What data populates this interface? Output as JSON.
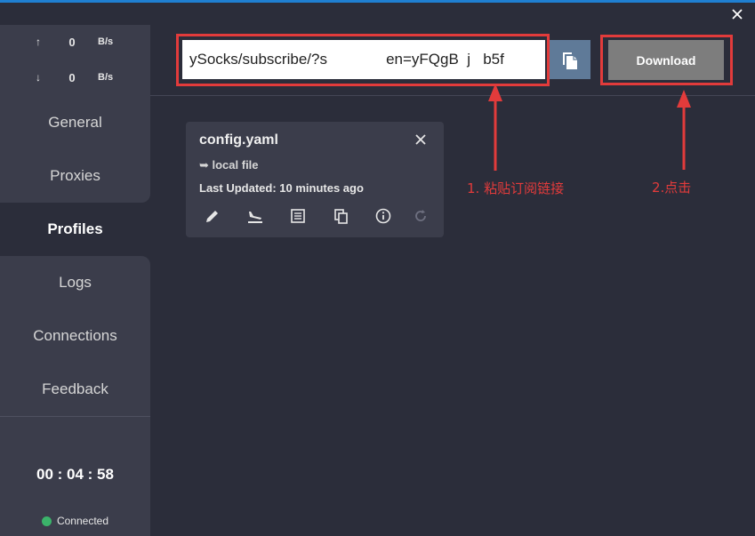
{
  "window": {
    "close_icon": "close-icon",
    "accent_color": "#1f7fd1"
  },
  "traffic": {
    "upload": {
      "arrow": "↑",
      "value": "0",
      "unit": "B/s"
    },
    "download": {
      "arrow": "↓",
      "value": "0",
      "unit": "B/s"
    }
  },
  "nav": {
    "items": [
      {
        "label": "General"
      },
      {
        "label": "Proxies"
      },
      {
        "label": "Profiles",
        "active": true
      },
      {
        "label": "Logs"
      },
      {
        "label": "Connections"
      },
      {
        "label": "Feedback"
      }
    ]
  },
  "status": {
    "timer": "00 : 04 : 58",
    "connection": "Connected",
    "dot_color": "#3bb36a"
  },
  "subscribe": {
    "url_value": "ySocks/subscribe/?s              en=yFQgB  j   b5f",
    "copy_icon": "copy-icon",
    "download_label": "Download"
  },
  "profile_card": {
    "title": "config.yaml",
    "source": "➥ local file",
    "last_updated": "Last Updated: 10 minutes ago",
    "actions": [
      "edit-icon",
      "flight-land-icon",
      "list-view-icon",
      "copy-icon",
      "info-icon",
      "refresh-icon"
    ]
  },
  "annotations": {
    "step1": "1. 粘贴订阅链接",
    "step2": "2.点击",
    "color": "#e23b3b"
  }
}
